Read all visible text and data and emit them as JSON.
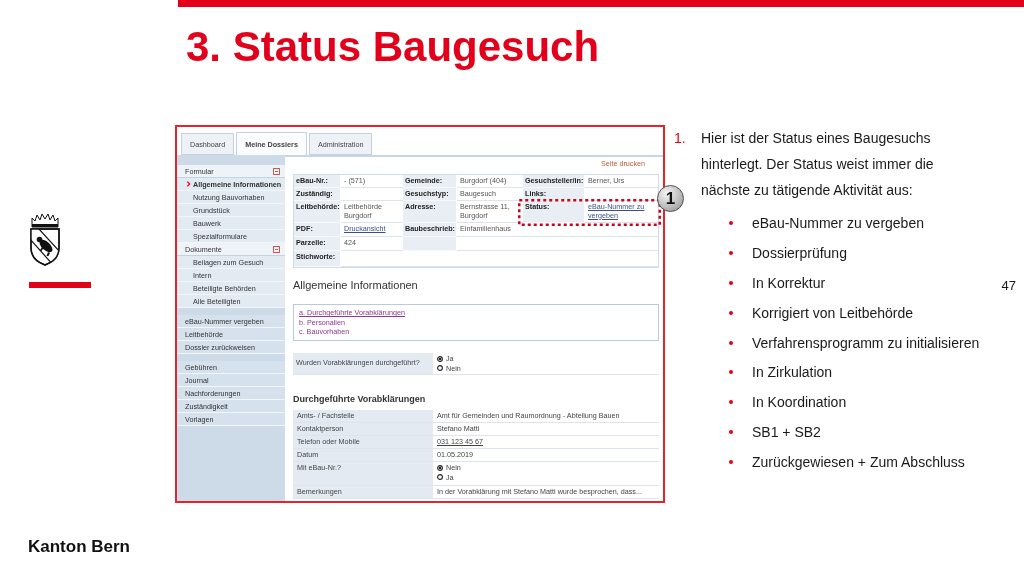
{
  "slide": {
    "title": "3. Status Baugesuch",
    "page_number": "47",
    "footer": "Kanton Bern"
  },
  "screenshot": {
    "tabs": [
      {
        "label": "Dashboard",
        "selected": false
      },
      {
        "label": "Meine Dossiers",
        "selected": true
      },
      {
        "label": "Administration",
        "selected": false
      }
    ],
    "sidebar": [
      {
        "kind": "section",
        "title": "Formular",
        "expanded": true,
        "items": [
          {
            "label": "Allgemeine Informationen",
            "selected": true
          },
          {
            "label": "Nutzung Bauvorhaben",
            "selected": false
          },
          {
            "label": "Grundstück",
            "selected": false
          },
          {
            "label": "Bauwerk",
            "selected": false
          },
          {
            "label": "Spezialformulare",
            "selected": false
          }
        ]
      },
      {
        "kind": "section",
        "title": "Dokumente",
        "expanded": true,
        "items": [
          {
            "label": "Beilagen zum Gesuch",
            "selected": false
          },
          {
            "label": "Intern",
            "selected": false
          },
          {
            "label": "Beteiligte Behörden",
            "selected": false
          },
          {
            "label": "Alle Beteiligten",
            "selected": false
          }
        ]
      },
      {
        "kind": "actions",
        "items": [
          {
            "label": "eBau-Nummer vergeben",
            "selected": false
          },
          {
            "label": "Leitbehörde",
            "selected": false
          },
          {
            "label": "Dossier zurückweisen",
            "selected": false
          }
        ]
      },
      {
        "kind": "actions",
        "items": [
          {
            "label": "Gebühren",
            "selected": false
          },
          {
            "label": "Journal",
            "selected": false
          },
          {
            "label": "Nachforderungen",
            "selected": false
          },
          {
            "label": "Zuständigkeit",
            "selected": false
          },
          {
            "label": "Vorlagen",
            "selected": false
          }
        ]
      }
    ],
    "print_link": "Seite drucken",
    "info_table": {
      "rows": [
        {
          "cells": [
            {
              "kind": "label",
              "text": "eBau-Nr.:"
            },
            {
              "kind": "value",
              "text": "- (571)"
            },
            {
              "kind": "label",
              "text": "Gemeinde:"
            },
            {
              "kind": "value",
              "text": "Burgdorf (404)"
            },
            {
              "kind": "label",
              "text": "Gesuchsteller/in:"
            },
            {
              "kind": "value",
              "text": "Berner, Urs"
            }
          ]
        },
        {
          "cells": [
            {
              "kind": "label",
              "text": "Zuständig:"
            },
            {
              "kind": "value"
            },
            {
              "kind": "label",
              "text": "Gesuchstyp:"
            },
            {
              "kind": "value",
              "text": "Baugesuch"
            },
            {
              "kind": "label",
              "text": "Links:"
            },
            {
              "kind": "value"
            }
          ]
        },
        {
          "cells": [
            {
              "kind": "label",
              "text": "Leitbehörde:"
            },
            {
              "kind": "value",
              "text": "Leitbehörde Burgdorf"
            },
            {
              "kind": "label",
              "text": "Adresse:"
            },
            {
              "kind": "value",
              "text": "Bernstrasse 11, Burgdorf"
            },
            {
              "kind": "label",
              "text": "Status:"
            },
            {
              "kind": "link",
              "text": "eBau-Nummer zu vergeben"
            }
          ]
        },
        {
          "cells": [
            {
              "kind": "label",
              "text": "PDF:"
            },
            {
              "kind": "link",
              "text": "Druckansicht"
            },
            {
              "kind": "label",
              "text": "Baubeschrieb:"
            },
            {
              "kind": "value",
              "text": "Einfamilienhaus"
            },
            {
              "kind": "value"
            }
          ]
        },
        {
          "cells": [
            {
              "kind": "label",
              "text": "Parzelle:"
            },
            {
              "kind": "value",
              "text": "424"
            },
            {
              "kind": "label"
            },
            {
              "kind": "value"
            }
          ]
        },
        {
          "cells": [
            {
              "kind": "label",
              "text": "Stichworte:"
            },
            {
              "kind": "value"
            }
          ]
        }
      ]
    },
    "section_title": "Allgemeine Informationen",
    "section_links": [
      {
        "label": "a. Durchgeführte Vorabklärungen",
        "selected": true
      },
      {
        "label": "b. Personalien",
        "selected": false
      },
      {
        "label": "c. Bauvorhaben",
        "selected": false
      }
    ],
    "question": {
      "label": "Wurden Vorabklärungen durchgeführt?",
      "options": [
        {
          "label": "Ja",
          "selected": true
        },
        {
          "label": "Nein",
          "selected": false
        }
      ]
    },
    "details": {
      "title": "Durchgeführte Vorabklärungen",
      "rows": [
        {
          "kind": "text",
          "label": "Amts- / Fachstelle",
          "value": "Amt für Gemeinden und Raumordnung - Abteilung Bauen"
        },
        {
          "kind": "text",
          "label": "Kontaktperson",
          "value": "Stefano Matti"
        },
        {
          "kind": "link",
          "label": "Telefon oder Mobile",
          "value": "031 123 45 67"
        },
        {
          "kind": "text",
          "label": "Datum",
          "value": "01.05.2019"
        },
        {
          "kind": "radio",
          "label": "Mit eBau-Nr.?",
          "options": [
            {
              "label": "Nein",
              "selected": true
            },
            {
              "label": "Ja",
              "selected": false
            }
          ]
        },
        {
          "kind": "text",
          "label": "Bemerkungen",
          "value": "In der Vorabklärung mit Stefano Matti wurde besprochen, dass..."
        }
      ]
    },
    "callout": {
      "label": "1"
    }
  },
  "notes": {
    "number": "1.",
    "text": "Hier ist der Status eines Baugesuchs hinterlegt. Der Status weist immer die nächste zu tätigende Aktivität aus:",
    "bullets": [
      "eBau-Nummer zu vergeben",
      "Dossierprüfung",
      "In Korrektur",
      "Korrigiert von Leitbehörde",
      "Verfahrensprogramm zu initialisieren",
      "In Zirkulation",
      "In Koordination",
      "SB1 + SB2",
      "Zurückgewiesen + Zum Abschluss"
    ]
  }
}
